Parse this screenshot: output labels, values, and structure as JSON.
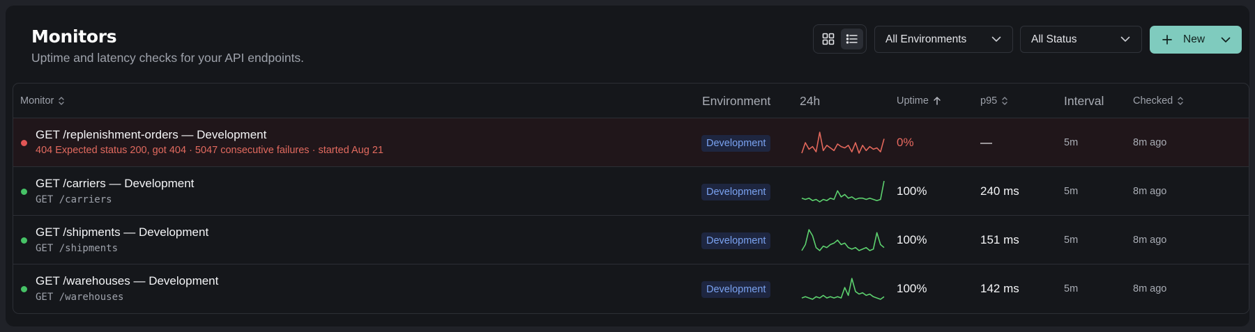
{
  "header": {
    "title": "Monitors",
    "subtitle": "Uptime and latency checks for your API endpoints."
  },
  "toolbar": {
    "view_modes": [
      {
        "name": "grid",
        "icon": "grid-icon",
        "active": false
      },
      {
        "name": "list",
        "icon": "list-icon",
        "active": true
      }
    ],
    "environment_select": "All Environments",
    "status_select": "All Status",
    "new_button": "New"
  },
  "table": {
    "columns": [
      {
        "label": "Monitor",
        "sort": "sortable"
      },
      {
        "label": "Environment",
        "sort": "none"
      },
      {
        "label": "24h",
        "sort": "none"
      },
      {
        "label": "Uptime",
        "sort": "ascending"
      },
      {
        "label": "p95",
        "sort": "sortable"
      },
      {
        "label": "Interval",
        "sort": "none"
      },
      {
        "label": "Checked",
        "sort": "sortable"
      }
    ],
    "rows": [
      {
        "status": "down",
        "name": "GET /replenishment-orders — Development",
        "detail": "404 Expected status 200, got 404 · 5047 consecutive failures · started Aug 21",
        "environment": "Development",
        "sparkline": [
          4,
          12,
          7,
          9,
          5,
          20,
          6,
          10,
          8,
          6,
          11,
          9,
          8,
          10,
          5,
          12,
          4,
          10,
          6,
          9,
          7,
          8,
          5,
          15
        ],
        "uptime": "0%",
        "p95": "—",
        "interval": "5m",
        "checked": "8m ago"
      },
      {
        "status": "up",
        "name": "GET /carriers — Development",
        "detail": "GET /carriers",
        "environment": "Development",
        "sparkline": [
          8,
          7,
          8,
          6,
          7,
          5,
          7,
          6,
          8,
          7,
          14,
          9,
          11,
          8,
          9,
          7,
          8,
          8,
          7,
          8,
          7,
          6,
          7,
          22
        ],
        "uptime": "100%",
        "p95": "240 ms",
        "interval": "5m",
        "checked": "8m ago"
      },
      {
        "status": "up",
        "name": "GET /shipments — Development",
        "detail": "GET /shipments",
        "environment": "Development",
        "sparkline": [
          6,
          10,
          20,
          16,
          8,
          6,
          9,
          8,
          10,
          11,
          13,
          10,
          11,
          8,
          7,
          8,
          6,
          7,
          8,
          6,
          7,
          18,
          10,
          8
        ],
        "uptime": "100%",
        "p95": "151 ms",
        "interval": "5m",
        "checked": "8m ago"
      },
      {
        "status": "up",
        "name": "GET /warehouses — Development",
        "detail": "GET /warehouses",
        "environment": "Development",
        "sparkline": [
          5,
          6,
          5,
          4,
          6,
          5,
          7,
          5,
          6,
          5,
          6,
          5,
          13,
          7,
          20,
          10,
          8,
          9,
          7,
          8,
          6,
          5,
          4,
          6
        ],
        "uptime": "100%",
        "p95": "142 ms",
        "interval": "5m",
        "checked": "8m ago"
      }
    ]
  },
  "colors": {
    "accent": "#7fcbbe",
    "status_down": "#e25555",
    "status_up": "#46c266",
    "spark_down": "#e4685c",
    "spark_up": "#5dd26f",
    "badge_text": "#7aa2f0"
  }
}
